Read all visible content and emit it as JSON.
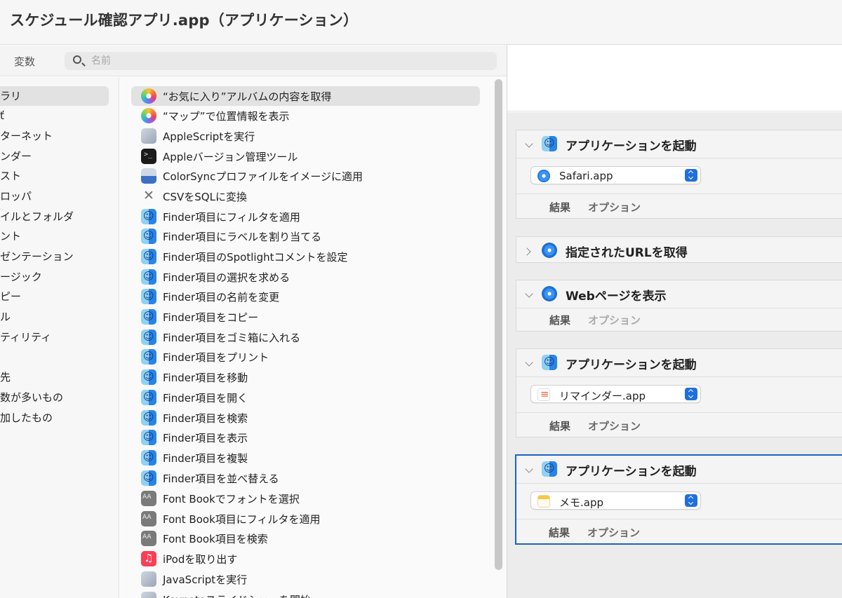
{
  "window": {
    "title": "スケジュール確認アプリ.app（アプリケーション）"
  },
  "library": {
    "variables_tab": "変数",
    "search": {
      "placeholder": "名前",
      "value": ""
    }
  },
  "categories": [
    {
      "label": "ラリ",
      "selected": true
    },
    {
      "label": "ť"
    },
    {
      "label": "ターネット"
    },
    {
      "label": "ンダー"
    },
    {
      "label": "スト"
    },
    {
      "label": "ロッパ"
    },
    {
      "label": "イルとフォルダ"
    },
    {
      "label": "ント"
    },
    {
      "label": "ゼンテーション"
    },
    {
      "label": "ージック"
    },
    {
      "label": "ピー"
    },
    {
      "label": "ル"
    },
    {
      "label": "ティリティ"
    },
    {
      "label": ""
    },
    {
      "label": "先"
    },
    {
      "label": "数が多いもの"
    },
    {
      "label": "加したもの"
    }
  ],
  "actions": [
    {
      "label": "“お気に入り”アルバムの内容を取得",
      "icon": "photos-icon",
      "selected": true
    },
    {
      "label": "“マップ”で位置情報を表示",
      "icon": "photos-icon"
    },
    {
      "label": "AppleScriptを実行",
      "icon": "script-editor-icon"
    },
    {
      "label": "Appleバージョン管理ツール",
      "icon": "terminal-icon"
    },
    {
      "label": "ColorSyncプロファイルをイメージに適用",
      "icon": "colorsync-icon"
    },
    {
      "label": "CSVをSQLに変換",
      "icon": "utilities-icon"
    },
    {
      "label": "Finder項目にフィルタを適用",
      "icon": "finder-icon"
    },
    {
      "label": "Finder項目にラベルを割り当てる",
      "icon": "finder-icon"
    },
    {
      "label": "Finder項目のSpotlightコメントを設定",
      "icon": "finder-icon"
    },
    {
      "label": "Finder項目の選択を求める",
      "icon": "finder-icon"
    },
    {
      "label": "Finder項目の名前を変更",
      "icon": "finder-icon"
    },
    {
      "label": "Finder項目をコピー",
      "icon": "finder-icon"
    },
    {
      "label": "Finder項目をゴミ箱に入れる",
      "icon": "finder-icon"
    },
    {
      "label": "Finder項目をプリント",
      "icon": "finder-icon"
    },
    {
      "label": "Finder項目を移動",
      "icon": "finder-icon"
    },
    {
      "label": "Finder項目を開く",
      "icon": "finder-icon"
    },
    {
      "label": "Finder項目を検索",
      "icon": "finder-icon"
    },
    {
      "label": "Finder項目を表示",
      "icon": "finder-icon"
    },
    {
      "label": "Finder項目を複製",
      "icon": "finder-icon"
    },
    {
      "label": "Finder項目を並べ替える",
      "icon": "finder-icon"
    },
    {
      "label": "Font Bookでフォントを選択",
      "icon": "font-book-icon"
    },
    {
      "label": "Font Book項目にフィルタを適用",
      "icon": "font-book-icon"
    },
    {
      "label": "Font Book項目を検索",
      "icon": "font-book-icon"
    },
    {
      "label": "iPodを取り出す",
      "icon": "music-icon"
    },
    {
      "label": "JavaScriptを実行",
      "icon": "script-editor-icon"
    },
    {
      "label": "Keynoteスライドショーを開始",
      "icon": "keynote-icon"
    }
  ],
  "workflow": {
    "cards": [
      {
        "title": "アプリケーションを起動",
        "icon": "finder-icon",
        "expanded": true,
        "select": {
          "value": "Safari.app",
          "icon": "safari-icon"
        },
        "tab_results": "結果",
        "tab_options": "オプション"
      },
      {
        "title": "指定されたURLを取得",
        "icon": "safari-icon",
        "expanded": false
      },
      {
        "title": "Webページを表示",
        "icon": "safari-icon",
        "expanded": true,
        "tab_results": "結果",
        "tab_options": "オプション"
      },
      {
        "title": "アプリケーションを起動",
        "icon": "finder-icon",
        "expanded": true,
        "select": {
          "value": "リマインダー.app",
          "icon": "reminders-icon"
        },
        "tab_results": "結果",
        "tab_options": "オプション"
      },
      {
        "title": "アプリケーションを起動",
        "icon": "finder-icon",
        "expanded": true,
        "active": true,
        "select": {
          "value": "メモ.app",
          "icon": "notes-icon"
        },
        "tab_results": "結果",
        "tab_options": "オプション"
      }
    ]
  },
  "colors": {
    "selection_border": "#1a63c9",
    "stepper_blue": "#1f6fde",
    "selected_row": "#e2e2e2"
  }
}
